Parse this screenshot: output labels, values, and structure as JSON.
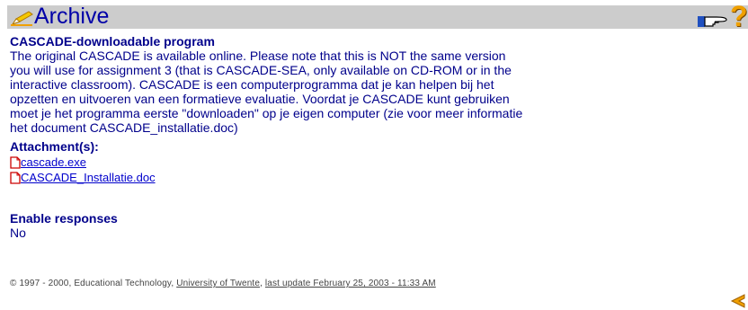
{
  "header": {
    "title": "Archive",
    "archive_icon": "pen-icon",
    "hand_icon": "pointing-hand-icon",
    "help_label": "?",
    "accent_color": "#0000a8",
    "bar_color": "#cccccc"
  },
  "item": {
    "title": "CASCADE-downloadable program",
    "description_lines": [
      "The original CASCADE is available online. Please note that this is NOT the same version",
      "you will use for assignment 3 (that is CASCADE-SEA, only available on CD-ROM or in the",
      "interactive classroom). CASCADE is een computerprogramma dat je kan helpen bij het",
      "opzetten en uitvoeren van een formatieve evaluatie. Voordat je CASCADE kunt gebruiken",
      "moet je het programma eerste \"downloaden\" op je eigen computer (zie voor meer informatie",
      "het document CASCADE_installatie.doc)"
    ]
  },
  "attachments": {
    "heading": "Attachment(s):",
    "files": [
      {
        "name": "cascade.exe",
        "icon": "document-icon"
      },
      {
        "name": "CASCADE_Installatie.doc",
        "icon": "document-icon"
      }
    ]
  },
  "responses": {
    "heading": "Enable responses",
    "value": "No"
  },
  "footer": {
    "copyright": "© 1997 - 2000, Educational Technology, ",
    "university": "University of Twente",
    "update_prefix": ", ",
    "last_update": "last update February 25, 2003 - 11:33 AM",
    "back_icon": "back-arrow-icon"
  }
}
